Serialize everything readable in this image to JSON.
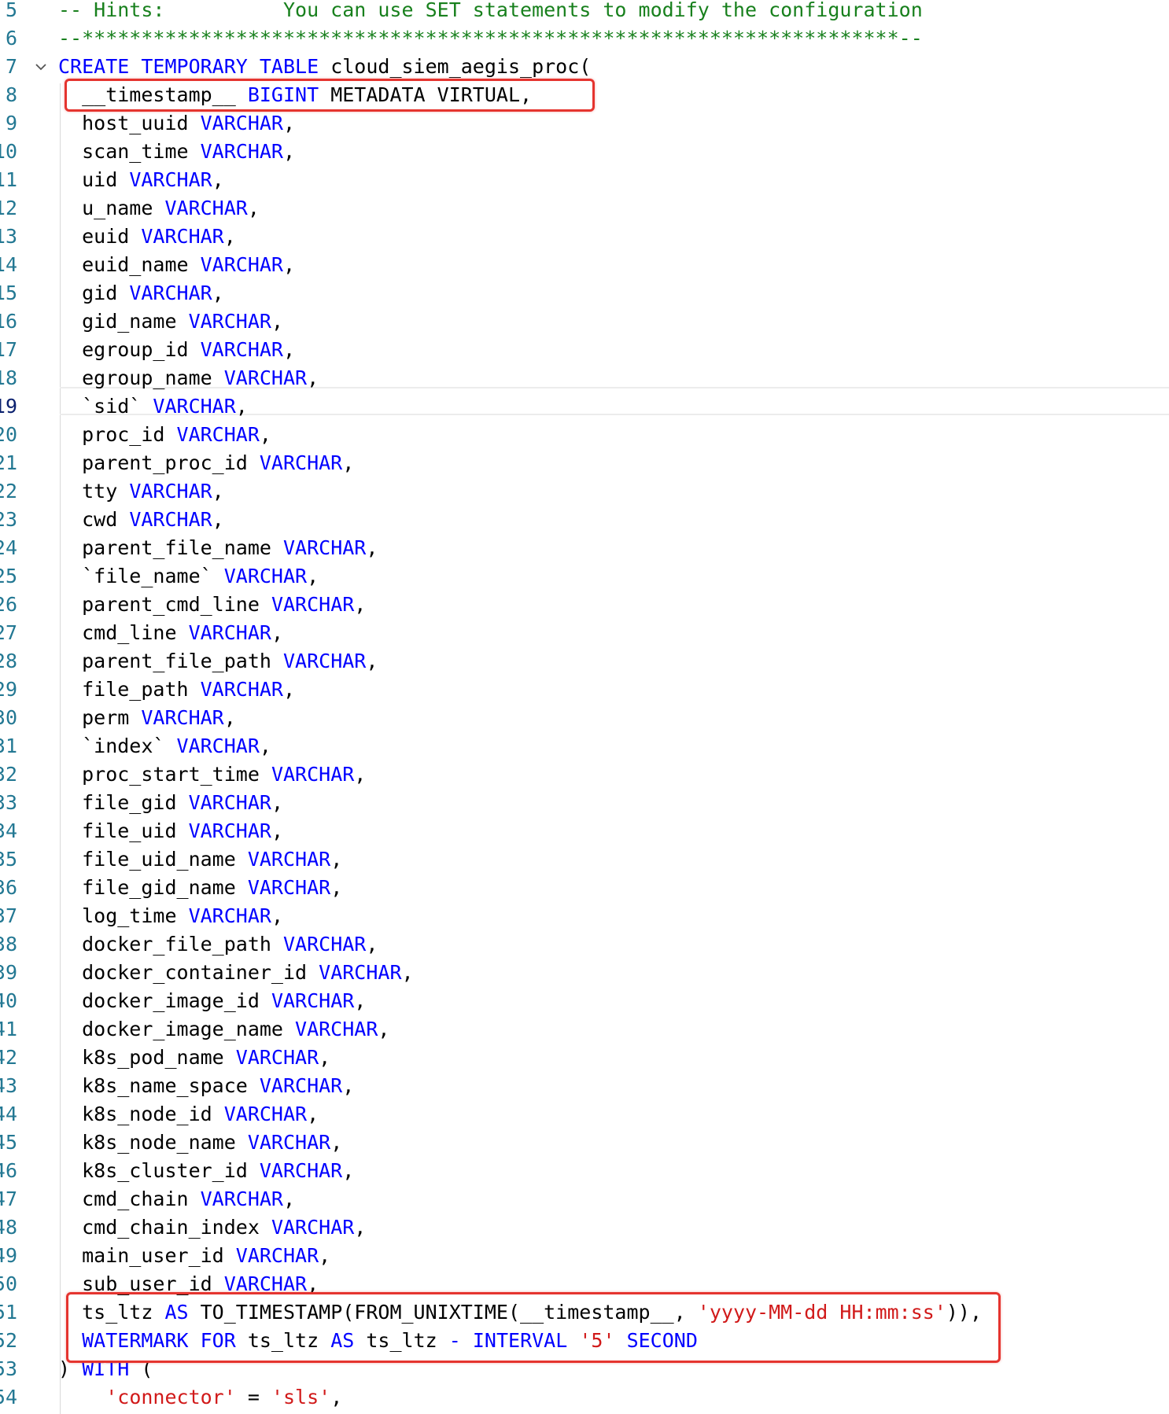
{
  "colors": {
    "keyword": "#0000ff",
    "string": "#d11a1a",
    "comment": "#18801d",
    "text": "#000000",
    "line_number": "#237893",
    "annotation_box": "#e5342f"
  },
  "editor": {
    "active_line": 19,
    "lines": [
      {
        "n": "5",
        "tokens": [
          {
            "t": "-- Hints:          You can use SET statements to modify the configuration",
            "c": "cmt"
          }
        ]
      },
      {
        "n": "6",
        "tokens": [
          {
            "t": "--*********************************************************************--",
            "c": "cmt"
          }
        ]
      },
      {
        "n": "7",
        "fold": true,
        "tokens": [
          {
            "t": "CREATE TEMPORARY TABLE",
            "c": "kw"
          },
          {
            "t": " cloud_siem_aegis_proc(",
            "c": "plain"
          }
        ]
      },
      {
        "n": "8",
        "tokens": [
          {
            "t": "  __timestamp__ ",
            "c": "plain"
          },
          {
            "t": "BIGINT",
            "c": "kw"
          },
          {
            "t": " METADATA VIRTUAL,",
            "c": "plain"
          }
        ]
      },
      {
        "n": "9",
        "tokens": [
          {
            "t": "  host_uuid ",
            "c": "plain"
          },
          {
            "t": "VARCHAR",
            "c": "kw"
          },
          {
            "t": ",",
            "c": "plain"
          }
        ]
      },
      {
        "n": "10",
        "tokens": [
          {
            "t": "  scan_time ",
            "c": "plain"
          },
          {
            "t": "VARCHAR",
            "c": "kw"
          },
          {
            "t": ",",
            "c": "plain"
          }
        ]
      },
      {
        "n": "11",
        "tokens": [
          {
            "t": "  uid ",
            "c": "plain"
          },
          {
            "t": "VARCHAR",
            "c": "kw"
          },
          {
            "t": ",",
            "c": "plain"
          }
        ]
      },
      {
        "n": "12",
        "tokens": [
          {
            "t": "  u_name ",
            "c": "plain"
          },
          {
            "t": "VARCHAR",
            "c": "kw"
          },
          {
            "t": ",",
            "c": "plain"
          }
        ]
      },
      {
        "n": "13",
        "tokens": [
          {
            "t": "  euid ",
            "c": "plain"
          },
          {
            "t": "VARCHAR",
            "c": "kw"
          },
          {
            "t": ",",
            "c": "plain"
          }
        ]
      },
      {
        "n": "14",
        "tokens": [
          {
            "t": "  euid_name ",
            "c": "plain"
          },
          {
            "t": "VARCHAR",
            "c": "kw"
          },
          {
            "t": ",",
            "c": "plain"
          }
        ]
      },
      {
        "n": "15",
        "tokens": [
          {
            "t": "  gid ",
            "c": "plain"
          },
          {
            "t": "VARCHAR",
            "c": "kw"
          },
          {
            "t": ",",
            "c": "plain"
          }
        ]
      },
      {
        "n": "16",
        "tokens": [
          {
            "t": "  gid_name ",
            "c": "plain"
          },
          {
            "t": "VARCHAR",
            "c": "kw"
          },
          {
            "t": ",",
            "c": "plain"
          }
        ]
      },
      {
        "n": "17",
        "tokens": [
          {
            "t": "  egroup_id ",
            "c": "plain"
          },
          {
            "t": "VARCHAR",
            "c": "kw"
          },
          {
            "t": ",",
            "c": "plain"
          }
        ]
      },
      {
        "n": "18",
        "tokens": [
          {
            "t": "  egroup_name ",
            "c": "plain"
          },
          {
            "t": "VARCHAR",
            "c": "kw"
          },
          {
            "t": ",",
            "c": "plain"
          }
        ]
      },
      {
        "n": "19",
        "tokens": [
          {
            "t": "  `sid` ",
            "c": "plain"
          },
          {
            "t": "VARCHAR",
            "c": "kw"
          },
          {
            "t": ",",
            "c": "plain"
          }
        ]
      },
      {
        "n": "20",
        "tokens": [
          {
            "t": "  proc_id ",
            "c": "plain"
          },
          {
            "t": "VARCHAR",
            "c": "kw"
          },
          {
            "t": ",",
            "c": "plain"
          }
        ]
      },
      {
        "n": "21",
        "tokens": [
          {
            "t": "  parent_proc_id ",
            "c": "plain"
          },
          {
            "t": "VARCHAR",
            "c": "kw"
          },
          {
            "t": ",",
            "c": "plain"
          }
        ]
      },
      {
        "n": "22",
        "tokens": [
          {
            "t": "  tty ",
            "c": "plain"
          },
          {
            "t": "VARCHAR",
            "c": "kw"
          },
          {
            "t": ",",
            "c": "plain"
          }
        ]
      },
      {
        "n": "23",
        "tokens": [
          {
            "t": "  cwd ",
            "c": "plain"
          },
          {
            "t": "VARCHAR",
            "c": "kw"
          },
          {
            "t": ",",
            "c": "plain"
          }
        ]
      },
      {
        "n": "24",
        "tokens": [
          {
            "t": "  parent_file_name ",
            "c": "plain"
          },
          {
            "t": "VARCHAR",
            "c": "kw"
          },
          {
            "t": ",",
            "c": "plain"
          }
        ]
      },
      {
        "n": "25",
        "tokens": [
          {
            "t": "  `file_name` ",
            "c": "plain"
          },
          {
            "t": "VARCHAR",
            "c": "kw"
          },
          {
            "t": ",",
            "c": "plain"
          }
        ]
      },
      {
        "n": "26",
        "tokens": [
          {
            "t": "  parent_cmd_line ",
            "c": "plain"
          },
          {
            "t": "VARCHAR",
            "c": "kw"
          },
          {
            "t": ",",
            "c": "plain"
          }
        ]
      },
      {
        "n": "27",
        "tokens": [
          {
            "t": "  cmd_line ",
            "c": "plain"
          },
          {
            "t": "VARCHAR",
            "c": "kw"
          },
          {
            "t": ",",
            "c": "plain"
          }
        ]
      },
      {
        "n": "28",
        "tokens": [
          {
            "t": "  parent_file_path ",
            "c": "plain"
          },
          {
            "t": "VARCHAR",
            "c": "kw"
          },
          {
            "t": ",",
            "c": "plain"
          }
        ]
      },
      {
        "n": "29",
        "tokens": [
          {
            "t": "  file_path ",
            "c": "plain"
          },
          {
            "t": "VARCHAR",
            "c": "kw"
          },
          {
            "t": ",",
            "c": "plain"
          }
        ]
      },
      {
        "n": "30",
        "tokens": [
          {
            "t": "  perm ",
            "c": "plain"
          },
          {
            "t": "VARCHAR",
            "c": "kw"
          },
          {
            "t": ",",
            "c": "plain"
          }
        ]
      },
      {
        "n": "31",
        "tokens": [
          {
            "t": "  `index` ",
            "c": "plain"
          },
          {
            "t": "VARCHAR",
            "c": "kw"
          },
          {
            "t": ",",
            "c": "plain"
          }
        ]
      },
      {
        "n": "32",
        "tokens": [
          {
            "t": "  proc_start_time ",
            "c": "plain"
          },
          {
            "t": "VARCHAR",
            "c": "kw"
          },
          {
            "t": ",",
            "c": "plain"
          }
        ]
      },
      {
        "n": "33",
        "tokens": [
          {
            "t": "  file_gid ",
            "c": "plain"
          },
          {
            "t": "VARCHAR",
            "c": "kw"
          },
          {
            "t": ",",
            "c": "plain"
          }
        ]
      },
      {
        "n": "34",
        "tokens": [
          {
            "t": "  file_uid ",
            "c": "plain"
          },
          {
            "t": "VARCHAR",
            "c": "kw"
          },
          {
            "t": ",",
            "c": "plain"
          }
        ]
      },
      {
        "n": "35",
        "tokens": [
          {
            "t": "  file_uid_name ",
            "c": "plain"
          },
          {
            "t": "VARCHAR",
            "c": "kw"
          },
          {
            "t": ",",
            "c": "plain"
          }
        ]
      },
      {
        "n": "36",
        "tokens": [
          {
            "t": "  file_gid_name ",
            "c": "plain"
          },
          {
            "t": "VARCHAR",
            "c": "kw"
          },
          {
            "t": ",",
            "c": "plain"
          }
        ]
      },
      {
        "n": "37",
        "tokens": [
          {
            "t": "  log_time ",
            "c": "plain"
          },
          {
            "t": "VARCHAR",
            "c": "kw"
          },
          {
            "t": ",",
            "c": "plain"
          }
        ]
      },
      {
        "n": "38",
        "tokens": [
          {
            "t": "  docker_file_path ",
            "c": "plain"
          },
          {
            "t": "VARCHAR",
            "c": "kw"
          },
          {
            "t": ",",
            "c": "plain"
          }
        ]
      },
      {
        "n": "39",
        "tokens": [
          {
            "t": "  docker_container_id ",
            "c": "plain"
          },
          {
            "t": "VARCHAR",
            "c": "kw"
          },
          {
            "t": ",",
            "c": "plain"
          }
        ]
      },
      {
        "n": "40",
        "tokens": [
          {
            "t": "  docker_image_id ",
            "c": "plain"
          },
          {
            "t": "VARCHAR",
            "c": "kw"
          },
          {
            "t": ",",
            "c": "plain"
          }
        ]
      },
      {
        "n": "41",
        "tokens": [
          {
            "t": "  docker_image_name ",
            "c": "plain"
          },
          {
            "t": "VARCHAR",
            "c": "kw"
          },
          {
            "t": ",",
            "c": "plain"
          }
        ]
      },
      {
        "n": "42",
        "tokens": [
          {
            "t": "  k8s_pod_name ",
            "c": "plain"
          },
          {
            "t": "VARCHAR",
            "c": "kw"
          },
          {
            "t": ",",
            "c": "plain"
          }
        ]
      },
      {
        "n": "43",
        "tokens": [
          {
            "t": "  k8s_name_space ",
            "c": "plain"
          },
          {
            "t": "VARCHAR",
            "c": "kw"
          },
          {
            "t": ",",
            "c": "plain"
          }
        ]
      },
      {
        "n": "44",
        "tokens": [
          {
            "t": "  k8s_node_id ",
            "c": "plain"
          },
          {
            "t": "VARCHAR",
            "c": "kw"
          },
          {
            "t": ",",
            "c": "plain"
          }
        ]
      },
      {
        "n": "45",
        "tokens": [
          {
            "t": "  k8s_node_name ",
            "c": "plain"
          },
          {
            "t": "VARCHAR",
            "c": "kw"
          },
          {
            "t": ",",
            "c": "plain"
          }
        ]
      },
      {
        "n": "46",
        "tokens": [
          {
            "t": "  k8s_cluster_id ",
            "c": "plain"
          },
          {
            "t": "VARCHAR",
            "c": "kw"
          },
          {
            "t": ",",
            "c": "plain"
          }
        ]
      },
      {
        "n": "47",
        "tokens": [
          {
            "t": "  cmd_chain ",
            "c": "plain"
          },
          {
            "t": "VARCHAR",
            "c": "kw"
          },
          {
            "t": ",",
            "c": "plain"
          }
        ]
      },
      {
        "n": "48",
        "tokens": [
          {
            "t": "  cmd_chain_index ",
            "c": "plain"
          },
          {
            "t": "VARCHAR",
            "c": "kw"
          },
          {
            "t": ",",
            "c": "plain"
          }
        ]
      },
      {
        "n": "49",
        "tokens": [
          {
            "t": "  main_user_id ",
            "c": "plain"
          },
          {
            "t": "VARCHAR",
            "c": "kw"
          },
          {
            "t": ",",
            "c": "plain"
          }
        ]
      },
      {
        "n": "50",
        "tokens": [
          {
            "t": "  sub_user_id ",
            "c": "plain"
          },
          {
            "t": "VARCHAR",
            "c": "kw"
          },
          {
            "t": ",",
            "c": "plain"
          }
        ]
      },
      {
        "n": "51",
        "tokens": [
          {
            "t": "  ts_ltz ",
            "c": "plain"
          },
          {
            "t": "AS",
            "c": "kw"
          },
          {
            "t": " TO_TIMESTAMP(FROM_UNIXTIME(__timestamp__, ",
            "c": "plain"
          },
          {
            "t": "'yyyy-MM-dd HH:mm:ss'",
            "c": "str"
          },
          {
            "t": ")),",
            "c": "plain"
          }
        ]
      },
      {
        "n": "52",
        "tokens": [
          {
            "t": "  ",
            "c": "plain"
          },
          {
            "t": "WATERMARK FOR",
            "c": "kw"
          },
          {
            "t": " ts_ltz ",
            "c": "plain"
          },
          {
            "t": "AS",
            "c": "kw"
          },
          {
            "t": " ts_ltz ",
            "c": "plain"
          },
          {
            "t": "-",
            "c": "kw"
          },
          {
            "t": " ",
            "c": "plain"
          },
          {
            "t": "INTERVAL",
            "c": "kw"
          },
          {
            "t": " ",
            "c": "plain"
          },
          {
            "t": "'5'",
            "c": "str"
          },
          {
            "t": " ",
            "c": "plain"
          },
          {
            "t": "SECOND",
            "c": "kw"
          }
        ]
      },
      {
        "n": "53",
        "tokens": [
          {
            "t": ") ",
            "c": "plain"
          },
          {
            "t": "WITH",
            "c": "kw"
          },
          {
            "t": " (",
            "c": "plain"
          }
        ]
      },
      {
        "n": "54",
        "tokens": [
          {
            "t": "    ",
            "c": "plain"
          },
          {
            "t": "'connector'",
            "c": "str"
          },
          {
            "t": " = ",
            "c": "plain"
          },
          {
            "t": "'sls'",
            "c": "str"
          },
          {
            "t": ",",
            "c": "plain"
          }
        ]
      }
    ]
  }
}
